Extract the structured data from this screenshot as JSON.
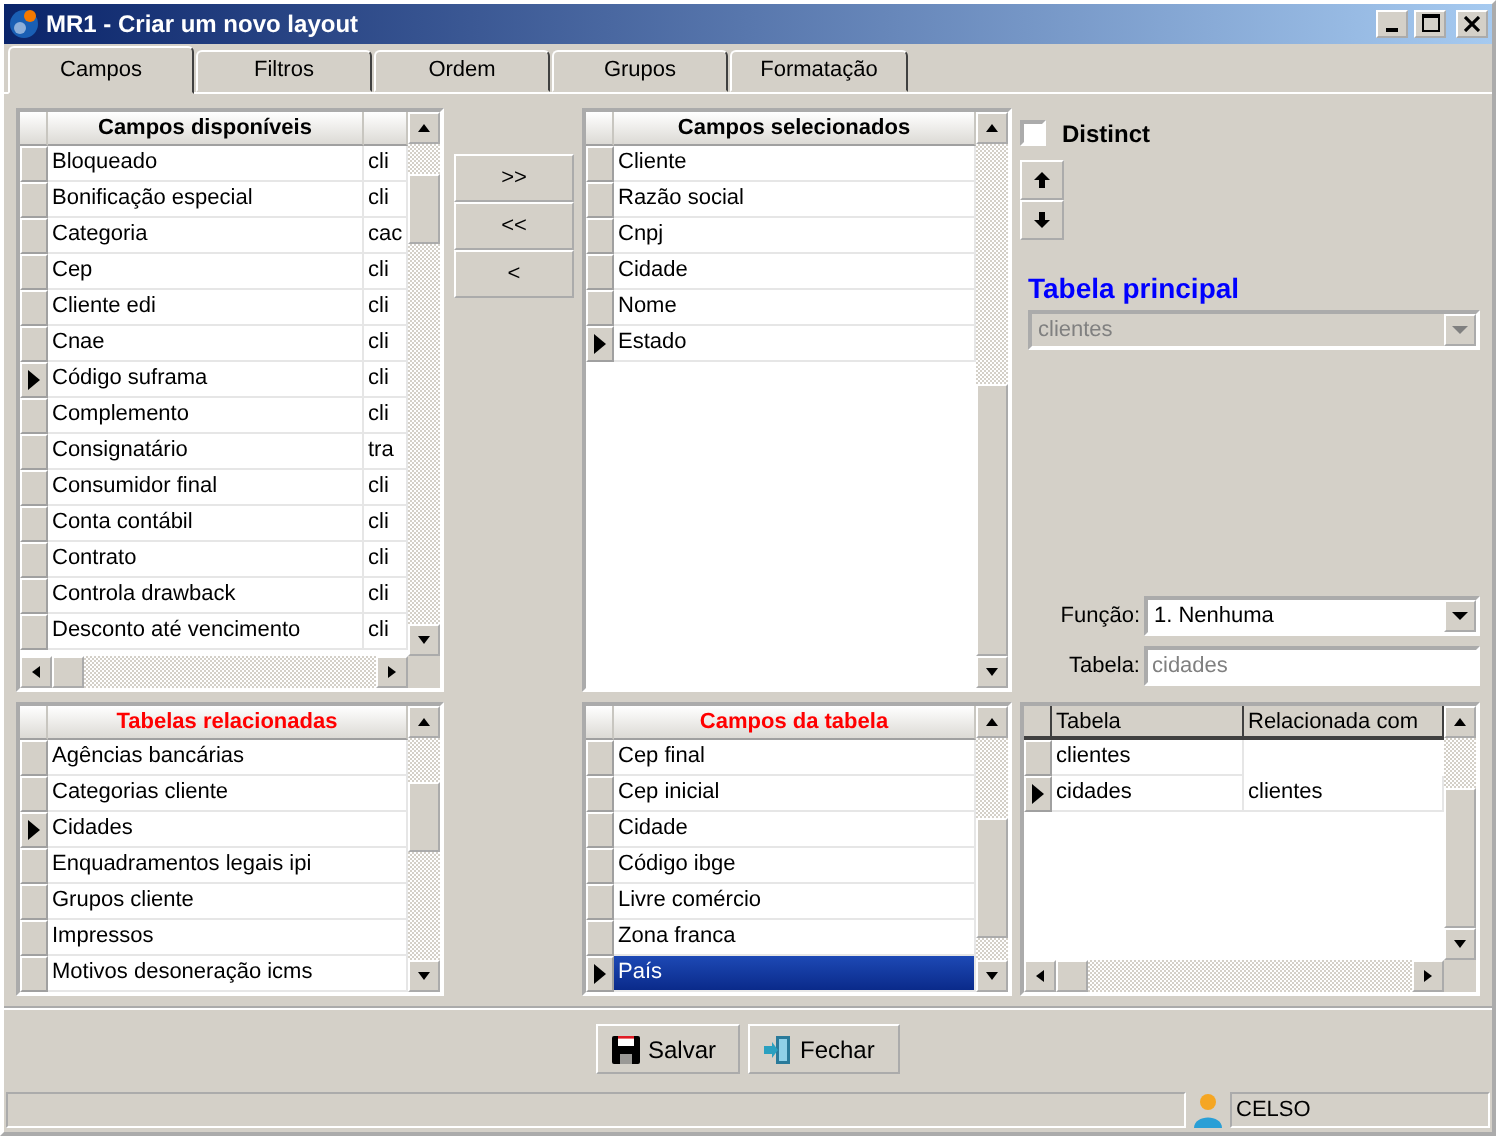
{
  "window": {
    "title": "MR1 - Criar um novo layout"
  },
  "tabs": [
    {
      "label": "Campos",
      "selected": true
    },
    {
      "label": "Filtros",
      "selected": false
    },
    {
      "label": "Ordem",
      "selected": false
    },
    {
      "label": "Grupos",
      "selected": false
    },
    {
      "label": "Formatação",
      "selected": false
    }
  ],
  "available_fields": {
    "title": "Campos disponíveis",
    "highlighted": false,
    "rows": [
      {
        "name": "Bloqueado",
        "table": "cli",
        "current": false
      },
      {
        "name": "Bonificação especial",
        "table": "cli",
        "current": false
      },
      {
        "name": "Categoria",
        "table": "cac",
        "current": false
      },
      {
        "name": "Cep",
        "table": "cli",
        "current": false
      },
      {
        "name": "Cliente edi",
        "table": "cli",
        "current": false
      },
      {
        "name": "Cnae",
        "table": "cli",
        "current": false
      },
      {
        "name": "Código suframa",
        "table": "cli",
        "current": true
      },
      {
        "name": "Complemento",
        "table": "cli",
        "current": false
      },
      {
        "name": "Consignatário",
        "table": "tra",
        "current": false
      },
      {
        "name": "Consumidor final",
        "table": "cli",
        "current": false
      },
      {
        "name": "Conta contábil",
        "table": "cli",
        "current": false
      },
      {
        "name": "Contrato",
        "table": "cli",
        "current": false
      },
      {
        "name": "Controla drawback",
        "table": "cli",
        "current": false
      },
      {
        "name": "Desconto até vencimento",
        "table": "cli",
        "current": false
      }
    ]
  },
  "move_buttons": [
    ">>",
    "<<",
    "<"
  ],
  "selected_fields": {
    "title": "Campos selecionados",
    "highlighted": false,
    "rows": [
      {
        "name": "Cliente",
        "current": false
      },
      {
        "name": "Razão social",
        "current": false
      },
      {
        "name": "Cnpj",
        "current": false
      },
      {
        "name": "Cidade",
        "current": false
      },
      {
        "name": "Nome",
        "current": false
      },
      {
        "name": "Estado",
        "current": true
      }
    ]
  },
  "distinct": {
    "label": "Distinct",
    "checked": false
  },
  "main_table": {
    "label": "Tabela principal",
    "value": "clientes",
    "disabled": true
  },
  "function_field": {
    "label": "Função:",
    "value": "1. Nenhuma"
  },
  "table_field": {
    "label": "Tabela:",
    "value": "cidades",
    "read_only": true
  },
  "related_tables": {
    "title": "Tabelas relacionadas",
    "highlighted": true,
    "rows": [
      {
        "name": "Agências bancárias",
        "current": false
      },
      {
        "name": "Categorias cliente",
        "current": false
      },
      {
        "name": "Cidades",
        "current": true
      },
      {
        "name": "Enquadramentos legais ipi",
        "current": false
      },
      {
        "name": "Grupos cliente",
        "current": false
      },
      {
        "name": "Impressos",
        "current": false
      },
      {
        "name": "Motivos desoneração icms",
        "current": false
      }
    ]
  },
  "table_fields": {
    "title": "Campos da tabela",
    "highlighted": true,
    "rows": [
      {
        "name": "Cep final",
        "current": false,
        "selected": false
      },
      {
        "name": "Cep inicial",
        "current": false,
        "selected": false
      },
      {
        "name": "Cidade",
        "current": false,
        "selected": false
      },
      {
        "name": "Código ibge",
        "current": false,
        "selected": false
      },
      {
        "name": "Livre comércio",
        "current": false,
        "selected": false
      },
      {
        "name": "Zona franca",
        "current": false,
        "selected": false
      },
      {
        "name": "País",
        "current": true,
        "selected": true
      }
    ]
  },
  "relations": {
    "columns": [
      "Tabela",
      "Relacionada com"
    ],
    "rows": [
      {
        "cells": [
          "clientes"
        ],
        "current": false
      },
      {
        "cells": [
          "cidades",
          "clientes"
        ],
        "current": true
      }
    ]
  },
  "buttons": [
    {
      "label": "Salvar",
      "kind": "save"
    },
    {
      "label": "Fechar",
      "kind": "close"
    }
  ],
  "status_bar": {
    "user": "CELSO"
  }
}
